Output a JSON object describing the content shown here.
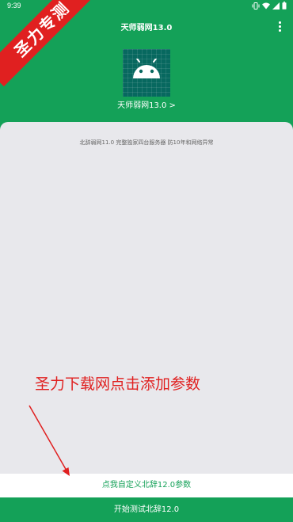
{
  "status_bar": {
    "time": "9:39",
    "icons": [
      "vibrate-icon",
      "wifi-icon",
      "signal-icon",
      "battery-icon"
    ]
  },
  "app_bar": {
    "title": "天师弱网13.0",
    "menu_icon": "more-vert-icon"
  },
  "app_info": {
    "icon": "android-icon",
    "link_label": "天师弱网13.0 >"
  },
  "content": {
    "description": "北辞弱网11.0 完整独家四台服务器 防10年和网络异常"
  },
  "overlay": {
    "ribbon_text": "圣力专测",
    "caption": "圣力下载网点击添加参数",
    "color": "#e02020"
  },
  "actions": {
    "custom_params_label": "点我自定义北辞12.0参数",
    "start_label": "开始测试北辞12.0"
  },
  "colors": {
    "primary": "#14a158",
    "card_background": "#e8e8ec",
    "accent_red": "#e02020"
  }
}
